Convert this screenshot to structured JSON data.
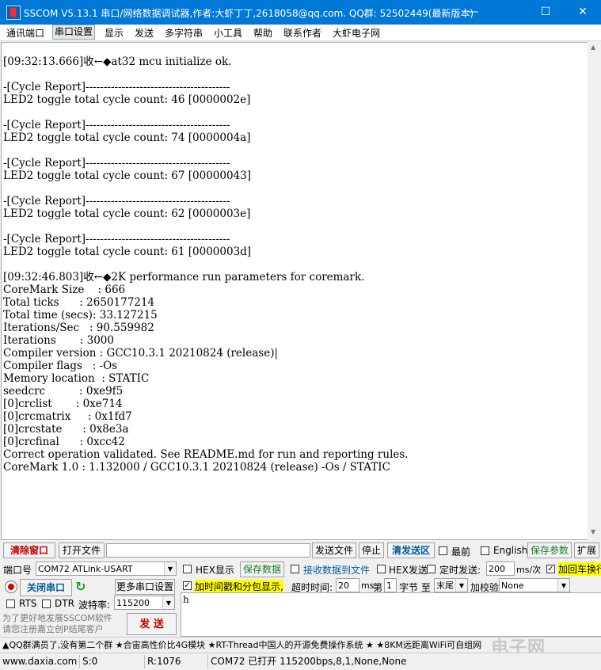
{
  "window": {
    "title": "SSCOM V5.13.1 串口/网络数据调试器,作者:大虾丁丁,2618058@qq.com. QQ群:  52502449(最新版本)"
  },
  "menu": [
    "通讯端口",
    "串口设置",
    "显示",
    "发送",
    "多字符串",
    "小工具",
    "帮助",
    "联系作者",
    "大虾电子网"
  ],
  "receive_lines": [
    "[09:32:13.666]收←◆at32 mcu initialize ok.",
    "",
    "-[Cycle Report]----------------------------------------",
    "LED2 toggle total cycle count: 46 [0000002e]",
    "",
    "-[Cycle Report]----------------------------------------",
    "LED2 toggle total cycle count: 74 [0000004a]",
    "",
    "-[Cycle Report]----------------------------------------",
    "LED2 toggle total cycle count: 67 [00000043]",
    "",
    "-[Cycle Report]----------------------------------------",
    "LED2 toggle total cycle count: 62 [0000003e]",
    "",
    "-[Cycle Report]----------------------------------------",
    "LED2 toggle total cycle count: 61 [0000003d]",
    "",
    "[09:32:46.803]收←◆2K performance run parameters for coremark.",
    "CoreMark Size    : 666",
    "Total ticks      : 2650177214",
    "Total time (secs): 33.127215",
    "Iterations/Sec   : 90.559982",
    "Iterations       : 3000",
    "Compiler version : GCC10.3.1 20210824 (release)|",
    "Compiler flags   : -Os",
    "Memory location  : STATIC",
    "seedcrc          : 0xe9f5",
    "[0]crclist       : 0xe714",
    "[0]crcmatrix     : 0x1fd7",
    "[0]crcstate      : 0x8e3a",
    "[0]crcfinal      : 0xcc42",
    "Correct operation validated. See README.md for run and reporting rules.",
    "CoreMark 1.0 : 1.132000 / GCC10.3.1 20210824 (release) -Os / STATIC"
  ],
  "toolbar1": {
    "clear_window": "清除窗口",
    "open_file": "打开文件",
    "file_path": "",
    "send_file": "发送文件",
    "stop": "停止",
    "clear_send": "清发送区",
    "front_most": "最前",
    "english": "English",
    "save_params": "保存参数",
    "expand": "扩展"
  },
  "toolbar2": {
    "port_label": "端口号",
    "port_value": "COM72 ATLink-USART",
    "hex_display": "HEX显示",
    "save_data": "保存数据",
    "recv_to_file": "接收数据到文件",
    "hex_send": "HEX发送",
    "timed_send": "定时发送:",
    "interval": "200",
    "interval_unit": "ms/次",
    "add_crlf": "加回车换行"
  },
  "toolbar3": {
    "close_port": "关闭串口",
    "more_settings": "更多串口设置",
    "add_timestamp": "加时间戳和分包显示,",
    "timeout_label": "超时时间:",
    "timeout": "20",
    "timeout_unit": "ms",
    "byte_prefix": "第",
    "byte_index": "1",
    "byte_label": "字节 至",
    "end_value": "末尾",
    "checksum_label": "加校验",
    "checksum_value": "None"
  },
  "toolbar4": {
    "rts": "RTS",
    "dtr": "DTR",
    "baud_label": "波特率:",
    "baud_value": "115200",
    "send": "发 送",
    "send_text": "h"
  },
  "promo": "为了更好地发展SSCOM软件\n请您注册嘉立创P结尾客户",
  "ticker": "▲QQ群满员了,没有第二个群  ★合宙高性价比4G模块  ★RT-Thread中国人的开源免费操作系统  ★  ★8KM远距离WiFi可自组网",
  "status": {
    "website": "www.daxia.com",
    "sent": "S:0",
    "received": "R:1076",
    "port_info": "COM72 已打开  115200bps,8,1,None,None"
  },
  "watermark": "电子网"
}
